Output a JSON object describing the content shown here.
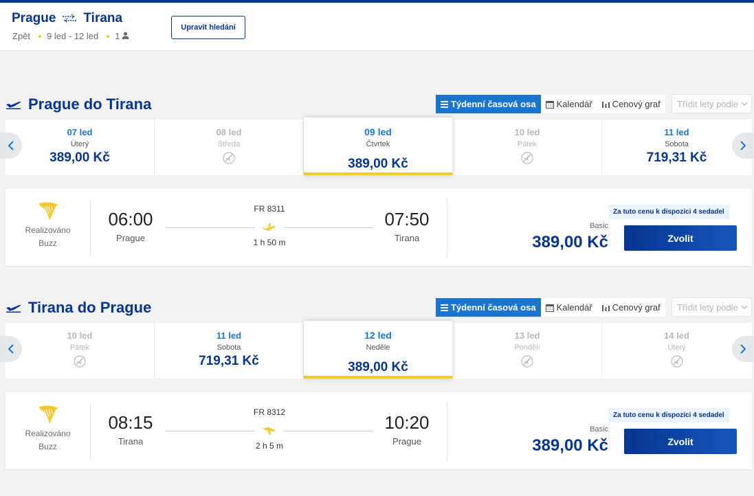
{
  "header": {
    "origin": "Prague",
    "destination": "Tirana",
    "trip_type": "Zpět",
    "dates": "9 led - 12 led",
    "passengers": "1",
    "edit_label": "Upravit hledání"
  },
  "colors": {
    "brand": "#073590",
    "accent_blue": "#1b75cf",
    "yellow": "#f1c933"
  },
  "view_toggle": {
    "weekly": "Týdenní časová osa",
    "calendar": "Kalendář",
    "chart": "Cenový graf",
    "sort_placeholder": "Třídit lety podle"
  },
  "outbound": {
    "title": "Prague do Tirana",
    "days": [
      {
        "date": "07 led",
        "weekday": "Úterý",
        "price": "389,00 Kč"
      },
      {
        "date": "08 led",
        "weekday": "Středa",
        "price": ""
      },
      {
        "date": "09 led",
        "weekday": "Čtvrtek",
        "price": "389,00 Kč"
      },
      {
        "date": "10 led",
        "weekday": "Pátek",
        "price": ""
      },
      {
        "date": "11 led",
        "weekday": "Sobota",
        "price": "719,31 Kč"
      }
    ],
    "flight": {
      "operator_line1": "Realizováno",
      "operator_line2": "Buzz",
      "depart_time": "06:00",
      "depart_city": "Prague",
      "flight_number": "FR 8311",
      "duration": "1 h 50 m",
      "arrive_time": "07:50",
      "arrive_city": "Tirana",
      "seats_note": "Za tuto cenu k dispozici 4 sedadel",
      "fare": "Basic",
      "price": "389,00 Kč",
      "select_label": "Zvolit"
    }
  },
  "inbound": {
    "title": "Tirana do Prague",
    "days": [
      {
        "date": "10 led",
        "weekday": "Pátek",
        "price": ""
      },
      {
        "date": "11 led",
        "weekday": "Sobota",
        "price": "719,31 Kč"
      },
      {
        "date": "12 led",
        "weekday": "Neděle",
        "price": "389,00 Kč"
      },
      {
        "date": "13 led",
        "weekday": "Pondělí",
        "price": ""
      },
      {
        "date": "14 led",
        "weekday": "Úterý",
        "price": ""
      }
    ],
    "flight": {
      "operator_line1": "Realizováno",
      "operator_line2": "Buzz",
      "depart_time": "08:15",
      "depart_city": "Tirana",
      "flight_number": "FR 8312",
      "duration": "2 h 5 m",
      "arrive_time": "10:20",
      "arrive_city": "Prague",
      "seats_note": "Za tuto cenu k dispozici 4 sedadel",
      "fare": "Basic",
      "price": "389,00 Kč",
      "select_label": "Zvolit"
    }
  }
}
